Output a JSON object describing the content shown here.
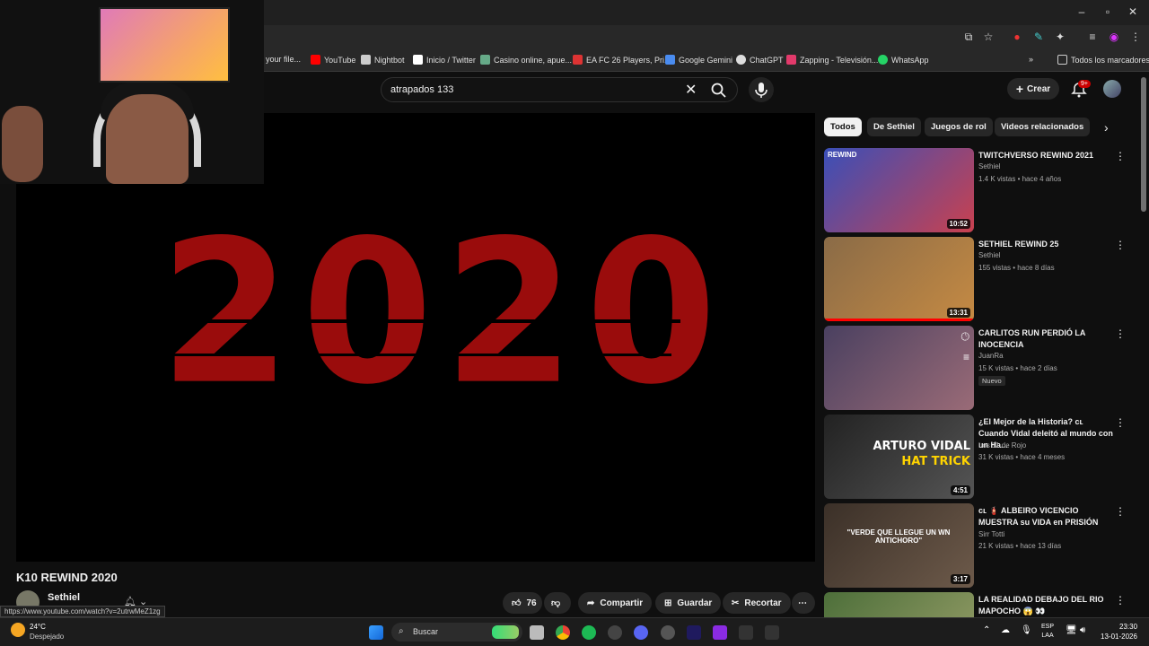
{
  "browser": {
    "bookmarks": [
      {
        "label": "your file...",
        "color": "#888888"
      },
      {
        "label": "YouTube",
        "color": "#ff0000"
      },
      {
        "label": "Nightbot",
        "color": "#cccccc"
      },
      {
        "label": "Inicio / Twitter",
        "color": "#ffffff"
      },
      {
        "label": "Casino online, apue...",
        "color": "#66aa88"
      },
      {
        "label": "EA FC 26 Players, Pri...",
        "color": "#d33"
      },
      {
        "label": "Google Gemini",
        "color": "#4a8cf0"
      },
      {
        "label": "ChatGPT",
        "color": "#dddddd"
      },
      {
        "label": "Zapping - Televisión...",
        "color": "#e23a6b"
      },
      {
        "label": "WhatsApp",
        "color": "#25d366"
      }
    ],
    "all_bookmarks": "Todos los marcadores"
  },
  "header": {
    "search_query": "atrapados 133",
    "create_label": "Crear",
    "notif_badge": "9+"
  },
  "video": {
    "overlay_text": "2020",
    "title": "K10 REWIND 2020",
    "channel": "Sethiel",
    "likes": "76",
    "share_label": "Compartir",
    "save_label": "Guardar",
    "clip_label": "Recortar",
    "status_url": "https://www.youtube.com/watch?v=2utrwMeZ1zg"
  },
  "chips": [
    "Todos",
    "De Sethiel",
    "Juegos de rol",
    "Videos relacionados"
  ],
  "recommendations": [
    {
      "title": "TWITCHVERSO REWIND 2021",
      "channel": "Sethiel",
      "meta": "1.4 K vistas • hace 4 años",
      "duration": "10:52",
      "thumb_label": "REWIND",
      "thumb_colors": [
        "#3a4fb8",
        "#c9414f"
      ]
    },
    {
      "title": "SETHIEL REWIND 25",
      "channel": "Sethiel",
      "meta": "155 vistas • hace 8 días",
      "duration": "13:31",
      "progress": 1.0,
      "thumb_colors": [
        "#8a6b47",
        "#c58a43"
      ]
    },
    {
      "title": "CARLITOS RUN PERDIÓ LA INOCENCIA",
      "channel": "JuanRa",
      "meta": "15 K vistas • hace 2 días",
      "badge": "Nuevo",
      "thumb_colors": [
        "#4a4060",
        "#9a6b77"
      ]
    },
    {
      "title": "¿El Mejor de la Historia? ᴄʟ Cuando Vidal deleitó al mundo con un Ha...",
      "channel": "Los 11 de Rojo",
      "meta": "31 K vistas • hace 4 meses",
      "duration": "4:51",
      "thumb_label": "ARTURO VIDAL",
      "thumb_label2": "HAT TRICK",
      "thumb_colors": [
        "#222222",
        "#555555"
      ]
    },
    {
      "title": "ᴄʟ 🧯 ALBEIRO VICENCIO MUESTRA su VIDA en PRISIÓN",
      "channel": "Sirr Totti",
      "meta": "21 K vistas • hace 13 días",
      "duration": "3:17",
      "thumb_label": "\"VERDE QUE LLEGUE UN WN ANTICHORO\"",
      "thumb_colors": [
        "#3b3028",
        "#6d5a4a"
      ]
    },
    {
      "title": "LA REALIDAD DEBAJO DEL RIO MAPOCHO 😱 👀",
      "channel": "",
      "meta": "",
      "thumb_colors": [
        "#4d6f3a",
        "#9aa06a"
      ]
    }
  ],
  "taskbar": {
    "temp": "24°C",
    "weather": "Despejado",
    "search": "Buscar",
    "lang1": "ESP",
    "lang2": "LAA",
    "time": "23:30",
    "date": "13-01-2026"
  }
}
